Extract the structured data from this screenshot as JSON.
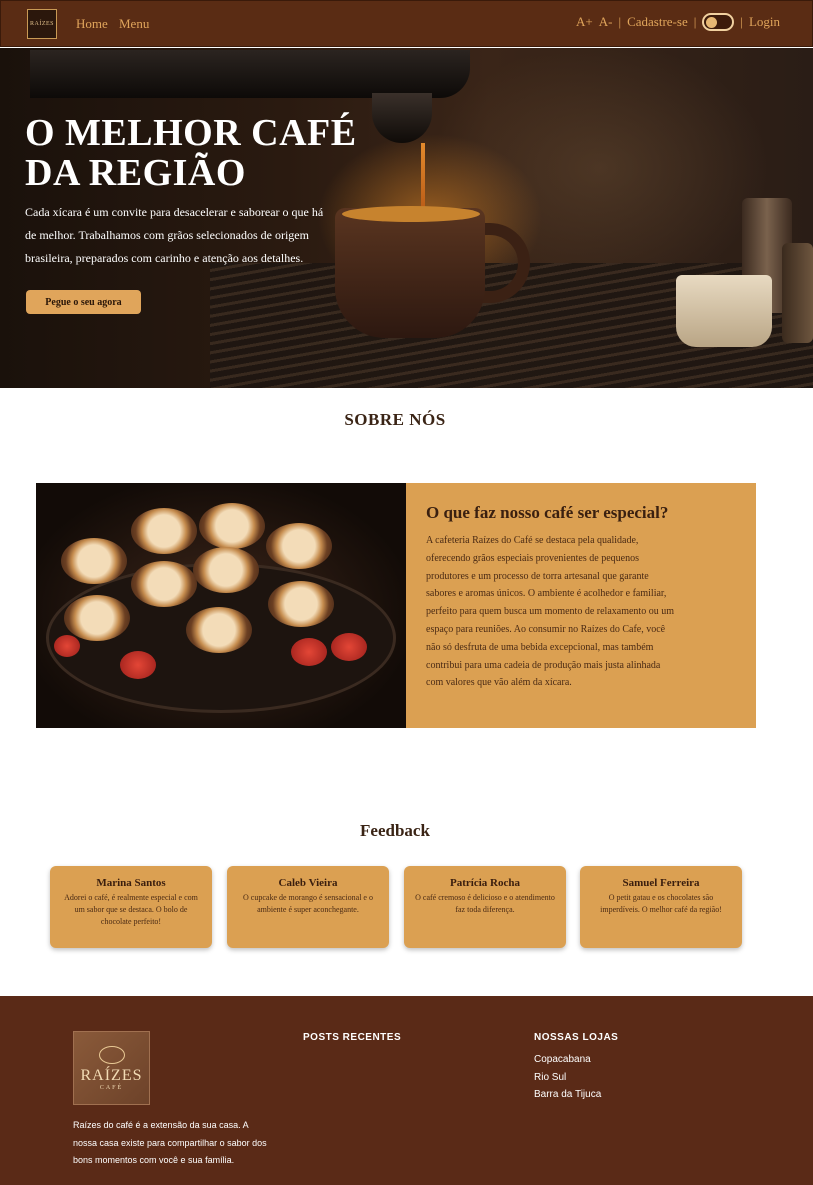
{
  "nav": {
    "logo_text": "RAÍZES",
    "home": "Home",
    "menu": "Menu",
    "font_increase": "A+",
    "font_decrease": "A-",
    "separator": "|",
    "signup": "Cadastre-se",
    "login": "Login"
  },
  "hero": {
    "title_line1": "O MELHOR CAFÉ",
    "title_line2": "DA REGIÃO",
    "text": "Cada xícara é um convite para desacelerar e saborear o que há de melhor. Trabalhamos com grãos selecionados de origem brasileira, preparados com carinho e atenção aos detalhes.",
    "button": "Pegue o seu agora"
  },
  "about": {
    "section_title": "SOBRE NÓS",
    "heading": "O que faz nosso café ser especial?",
    "text": "A cafeteria Raízes do Café se destaca pela qualidade, oferecendo grãos especiais provenientes de pequenos produtores e um processo de torra artesanal que garante sabores e aromas únicos. O ambiente é acolhedor e familiar, perfeito para quem busca um momento de relaxamento ou um espaço para reuniões. Ao consumir no Raízes do Cafe, você não só desfruta de uma bebida excepcional, mas também contribui para uma cadeia de produção mais justa alinhada com valores que vão além da xícara."
  },
  "feedback": {
    "title": "Feedback",
    "cards": [
      {
        "name": "Marina Santos",
        "text": "Adorei o café, é realmente especial e com um sabor que se destaca. O bolo de chocolate perfeito!"
      },
      {
        "name": "Caleb Vieira",
        "text": "O cupcake de morango é sensacional e o ambiente é super aconchegante."
      },
      {
        "name": "Patrícia Rocha",
        "text": "O café cremoso é delicioso e o atendimento faz toda diferença."
      },
      {
        "name": "Samuel Ferreira",
        "text": "O petit gatau e os chocolates são imperdíveis. O melhor café da região!"
      }
    ]
  },
  "footer": {
    "logo_text": "RAÍZES",
    "logo_sub": "CAFÉ",
    "about_text": "Raízes do café é a extensão da sua casa. A nossa casa existe para compartilhar o sabor dos bons momentos com você e sua família.",
    "posts_heading": "POSTS RECENTES",
    "stores_heading": "NOSSAS LOJAS",
    "stores": [
      "Copacabana",
      "Rio Sul",
      "Barra da Tijuca"
    ]
  },
  "colors": {
    "nav_bg": "#5a2c14",
    "accent": "#e0a55b",
    "card_bg": "#dba052",
    "footer_bg": "#5a2a17"
  },
  "icons": {
    "theme_toggle": "theme-toggle-icon",
    "logo": "raizes-logo-icon"
  }
}
